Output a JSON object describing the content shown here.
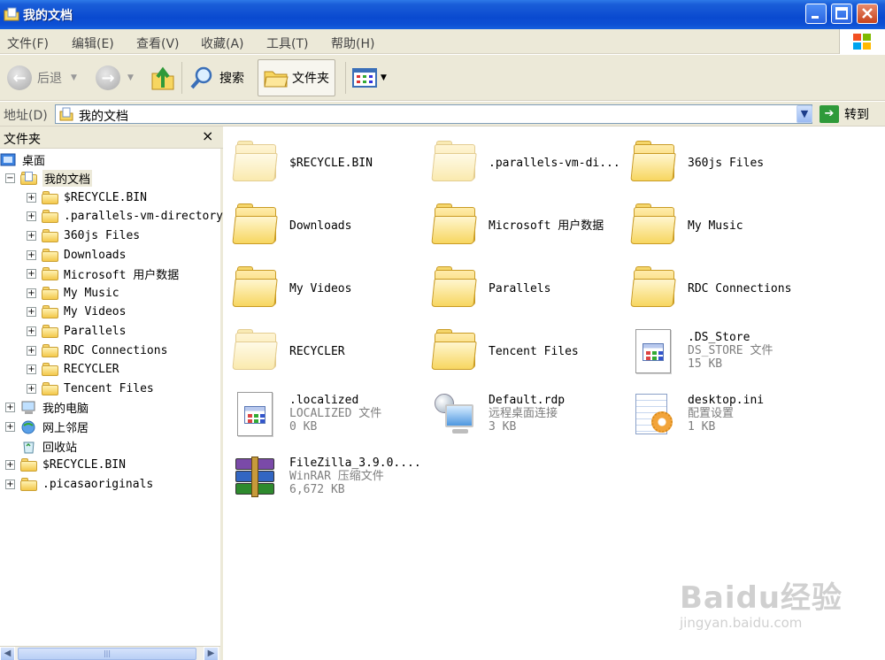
{
  "window": {
    "title": "我的文档"
  },
  "menu": [
    "文件(F)",
    "编辑(E)",
    "查看(V)",
    "收藏(A)",
    "工具(T)",
    "帮助(H)"
  ],
  "toolbar": {
    "back": "后退",
    "search": "搜索",
    "folders": "文件夹"
  },
  "address": {
    "label": "地址(D)",
    "value": "我的文档",
    "go": "转到"
  },
  "folder_pane": {
    "title": "文件夹",
    "close": "×",
    "tree": [
      {
        "label": "桌面",
        "level": 0,
        "expander": "",
        "icon": "desktop-icon"
      },
      {
        "label": "我的文档",
        "level": 1,
        "expander": "−",
        "icon": "my-documents-icon",
        "selected": true
      },
      {
        "label": "$RECYCLE.BIN",
        "level": 2,
        "expander": "+",
        "icon": "folder-icon"
      },
      {
        "label": ".parallels-vm-directory",
        "level": 2,
        "expander": "+",
        "icon": "folder-icon"
      },
      {
        "label": "360js Files",
        "level": 2,
        "expander": "+",
        "icon": "folder-icon"
      },
      {
        "label": "Downloads",
        "level": 2,
        "expander": "+",
        "icon": "folder-icon"
      },
      {
        "label": "Microsoft 用户数据",
        "level": 2,
        "expander": "+",
        "icon": "folder-icon"
      },
      {
        "label": "My Music",
        "level": 2,
        "expander": "+",
        "icon": "folder-icon"
      },
      {
        "label": "My Videos",
        "level": 2,
        "expander": "+",
        "icon": "folder-icon"
      },
      {
        "label": "Parallels",
        "level": 2,
        "expander": "+",
        "icon": "folder-icon"
      },
      {
        "label": "RDC Connections",
        "level": 2,
        "expander": "+",
        "icon": "folder-icon"
      },
      {
        "label": "RECYCLER",
        "level": 2,
        "expander": "+",
        "icon": "folder-icon"
      },
      {
        "label": "Tencent Files",
        "level": 2,
        "expander": "+",
        "icon": "folder-icon"
      },
      {
        "label": "我的电脑",
        "level": 1,
        "expander": "+",
        "icon": "my-computer-icon"
      },
      {
        "label": "网上邻居",
        "level": 1,
        "expander": "+",
        "icon": "network-icon"
      },
      {
        "label": "回收站",
        "level": 1,
        "expander": "",
        "icon": "recycle-bin-icon"
      },
      {
        "label": "$RECYCLE.BIN",
        "level": 1,
        "expander": "+",
        "icon": "folder-icon"
      },
      {
        "label": ".picasaoriginals",
        "level": 1,
        "expander": "+",
        "icon": "folder-icon"
      }
    ]
  },
  "items": [
    {
      "name": "$RECYCLE.BIN",
      "type": "",
      "size": "",
      "icon": "hidden-folder-icon"
    },
    {
      "name": ".parallels-vm-di...",
      "type": "",
      "size": "",
      "icon": "hidden-folder-icon"
    },
    {
      "name": "360js Files",
      "type": "",
      "size": "",
      "icon": "folder-icon"
    },
    {
      "name": "Downloads",
      "type": "",
      "size": "",
      "icon": "folder-icon"
    },
    {
      "name": "Microsoft 用户数据",
      "type": "",
      "size": "",
      "icon": "folder-icon"
    },
    {
      "name": "My Music",
      "type": "",
      "size": "",
      "icon": "folder-icon"
    },
    {
      "name": "My Videos",
      "type": "",
      "size": "",
      "icon": "folder-icon"
    },
    {
      "name": "Parallels",
      "type": "",
      "size": "",
      "icon": "folder-icon"
    },
    {
      "name": "RDC Connections",
      "type": "",
      "size": "",
      "icon": "folder-icon"
    },
    {
      "name": "RECYCLER",
      "type": "",
      "size": "",
      "icon": "hidden-folder-icon"
    },
    {
      "name": "Tencent Files",
      "type": "",
      "size": "",
      "icon": "folder-icon"
    },
    {
      "name": ".DS_Store",
      "type": "DS_STORE 文件",
      "size": "15 KB",
      "icon": "file-icon"
    },
    {
      "name": ".localized",
      "type": "LOCALIZED 文件",
      "size": "0 KB",
      "icon": "file-icon"
    },
    {
      "name": "Default.rdp",
      "type": "远程桌面连接",
      "size": "3 KB",
      "icon": "rdp-icon"
    },
    {
      "name": "desktop.ini",
      "type": "配置设置",
      "size": "1 KB",
      "icon": "ini-icon"
    },
    {
      "name": "FileZilla_3.9.0....",
      "type": "WinRAR 压缩文件",
      "size": "6,672 KB",
      "icon": "rar-icon"
    }
  ],
  "watermark": {
    "brand": "Baidu经验",
    "url": "jingyan.baidu.com"
  }
}
